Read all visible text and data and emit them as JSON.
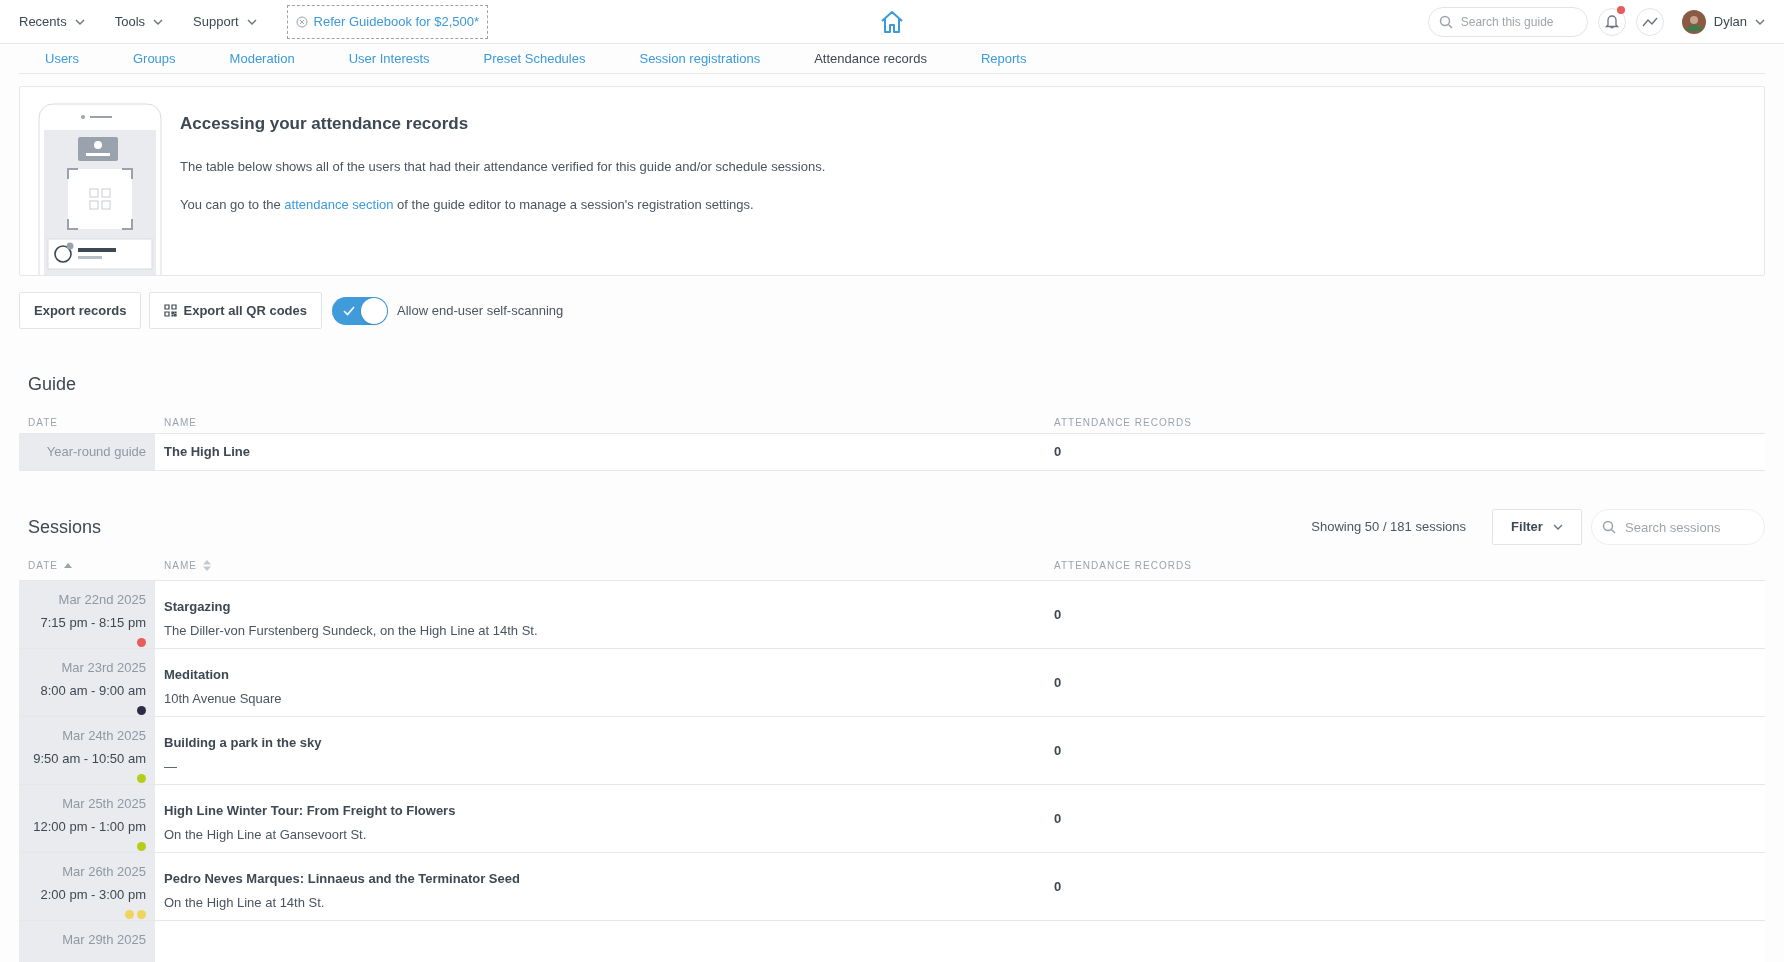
{
  "top_nav": {
    "menus": [
      "Recents",
      "Tools",
      "Support"
    ],
    "referral": "Refer Guidebook for $2,500*",
    "search": {
      "placeholder": "Search this guide"
    },
    "notifications": {
      "unread": true
    },
    "user": "Dylan"
  },
  "tabs": [
    {
      "label": "Users",
      "selected": false
    },
    {
      "label": "Groups",
      "selected": false
    },
    {
      "label": "Moderation",
      "selected": false
    },
    {
      "label": "User Interests",
      "selected": false
    },
    {
      "label": "Preset Schedules",
      "selected": false
    },
    {
      "label": "Session registrations",
      "selected": false
    },
    {
      "label": "Attendance records",
      "selected": true
    },
    {
      "label": "Reports",
      "selected": false
    }
  ],
  "info_card": {
    "title": "Accessing your attendance records",
    "paragraphs": [
      "The table below shows all of the users that had their attendance verified for this guide and/or schedule sessions.",
      {
        "before": "You can go to the ",
        "link": "attendance section",
        "after": " of the guide editor to manage a session's registration settings."
      }
    ]
  },
  "actions": {
    "export_records": "Export records",
    "export_qr": "Export all QR codes",
    "toggle": {
      "label": "Allow end-user self-scanning",
      "on": true
    }
  },
  "guide": {
    "heading": "Guide",
    "columns": [
      "DATE",
      "NAME",
      "ATTENDANCE RECORDS"
    ],
    "row": {
      "date": "Year-round guide",
      "name": "The High Line",
      "records": "0"
    }
  },
  "sessions": {
    "heading": "Sessions",
    "count": "Showing 50 / 181 sessions",
    "filter": "Filter",
    "search": {
      "placeholder": "Search sessions"
    },
    "columns": [
      "DATE",
      "NAME",
      "ATTENDANCE RECORDS"
    ],
    "rows": [
      {
        "date": "Mar 22nd 2025",
        "time": "7:15 pm - 8:15 pm",
        "name": "Stargazing",
        "location": "The Diller-von Furstenberg Sundeck, on the High Line at 14th St.",
        "records": "0",
        "dots": [
          {
            "color": "#e85c5c"
          }
        ]
      },
      {
        "date": "Mar 23rd 2025",
        "time": "8:00 am - 9:00 am",
        "name": "Meditation",
        "location": "10th Avenue Square",
        "records": "0",
        "dots": [
          {
            "color": "#2a2c45"
          }
        ]
      },
      {
        "date": "Mar 24th 2025",
        "time": "9:50 am - 10:50 am",
        "name": "Building a park in the sky",
        "location": "—",
        "records": "0",
        "dots": [
          {
            "color": "#b5cc18"
          }
        ]
      },
      {
        "date": "Mar 25th 2025",
        "time": "12:00 pm - 1:00 pm",
        "name": "High Line Winter Tour: From Freight to Flowers",
        "location": "On the High Line at Gansevoort St.",
        "records": "0",
        "dots": [
          {
            "color": "#b5cc18"
          }
        ]
      },
      {
        "date": "Mar 26th 2025",
        "time": "2:00 pm - 3:00 pm",
        "name": "Pedro Neves Marques: Linnaeus and the Terminator Seed",
        "location": "On the High Line at 14th St.",
        "records": "0",
        "dots": [
          {
            "color": "#f0d45c"
          },
          {
            "color": "#f0d45c"
          }
        ]
      },
      {
        "date": "Mar 29th 2025"
      }
    ]
  }
}
